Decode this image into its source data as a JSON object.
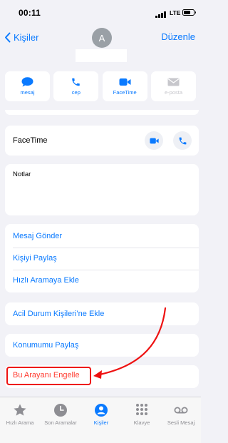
{
  "status_bar": {
    "time": "00:11",
    "network": "LTE"
  },
  "nav": {
    "back_label": "Kişiler",
    "edit_label": "Düzenle",
    "avatar_letter": "A"
  },
  "actions": [
    {
      "label": "mesaj",
      "icon": "message-icon"
    },
    {
      "label": "cep",
      "icon": "phone-icon"
    },
    {
      "label": "FaceTime",
      "icon": "video-icon"
    },
    {
      "label": "e-posta",
      "icon": "mail-icon"
    }
  ],
  "facetime_row": {
    "label": "FaceTime"
  },
  "notes": {
    "label": "Notlar"
  },
  "menu": {
    "send_message": "Mesaj Gönder",
    "share_contact": "Kişiyi Paylaş",
    "add_favorites": "Hızlı Aramaya Ekle",
    "add_emergency": "Acil Durum Kişileri’ne Ekle",
    "share_location": "Konumumu Paylaş",
    "block_caller": "Bu Arayanı Engelle"
  },
  "tabs": [
    {
      "label": "Hızlı Arama",
      "icon": "star-icon"
    },
    {
      "label": "Son Aramalar",
      "icon": "clock-icon"
    },
    {
      "label": "Kişiler",
      "icon": "person-icon"
    },
    {
      "label": "Klavye",
      "icon": "keypad-icon"
    },
    {
      "label": "Sesli Mesaj",
      "icon": "voicemail-icon"
    }
  ],
  "colors": {
    "accent": "#0a7aff",
    "destructive": "#ff3b30",
    "annotation": "#ee1111"
  }
}
